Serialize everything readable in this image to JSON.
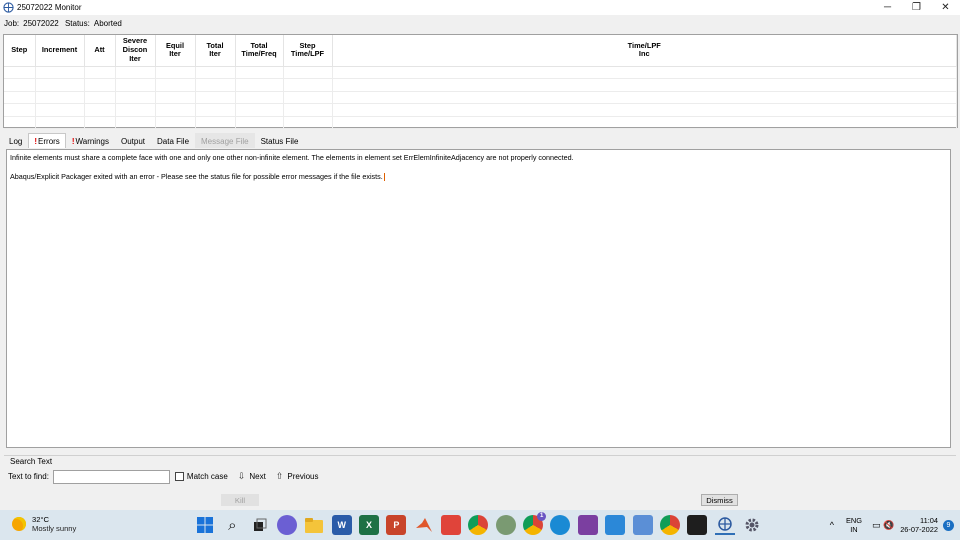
{
  "window": {
    "title": "25072022 Monitor",
    "minimize_glyph": "─",
    "maximize_glyph": "❐",
    "close_glyph": "✕"
  },
  "job": {
    "label": "Job:",
    "name": "25072022",
    "status_label": "Status:",
    "status": "Aborted"
  },
  "table": {
    "headers": {
      "step": "Step",
      "increment": "Increment",
      "att": "Att",
      "severe_l1": "Severe",
      "severe_l2": "Discon",
      "severe_l3": "Iter",
      "equil_l1": "Equil",
      "equil_l2": "Iter",
      "total_iter_l1": "Total",
      "total_iter_l2": "Iter",
      "total_time_l1": "Total",
      "total_time_l2": "Time/Freq",
      "step_time_l1": "Step",
      "step_time_l2": "Time/LPF",
      "timelpf_l1": "Time/LPF",
      "timelpf_l2": "Inc"
    }
  },
  "tabs": {
    "log": "Log",
    "errors": "Errors",
    "warnings": "Warnings",
    "output": "Output",
    "data_file": "Data File",
    "message_file": "Message File",
    "status_file": "Status File",
    "alert_glyph": "!"
  },
  "log": {
    "line1": "Infinite elements must share a complete face with one and only one other non-infinite element.  The elements in element set ErrElemInfiniteAdjacency are not properly connected.",
    "line2": "Abaqus/Explicit Packager exited with an error - Please see the  status file for possible error messages if the file exists."
  },
  "search": {
    "legend": "Search Text",
    "find_label": "Text to find:",
    "find_value": "",
    "match_case": "Match case",
    "next": "Next",
    "previous": "Previous",
    "next_glyph": "⇩",
    "previous_glyph": "⇧"
  },
  "buttons": {
    "kill": "Kill",
    "dismiss": "Dismiss"
  },
  "taskbar": {
    "temperature": "32°C",
    "weather": "Mostly sunny",
    "search_glyph": "⌕",
    "word_glyph": "W",
    "excel_glyph": "X",
    "powerpoint_glyph": "P",
    "language_l1": "ENG",
    "language_l2": "IN",
    "chevron_glyph": "^",
    "tray_glyph": "▭ 🔇",
    "time": "11:04",
    "date": "26-07-2022",
    "notifications": "9",
    "badge": "1"
  }
}
